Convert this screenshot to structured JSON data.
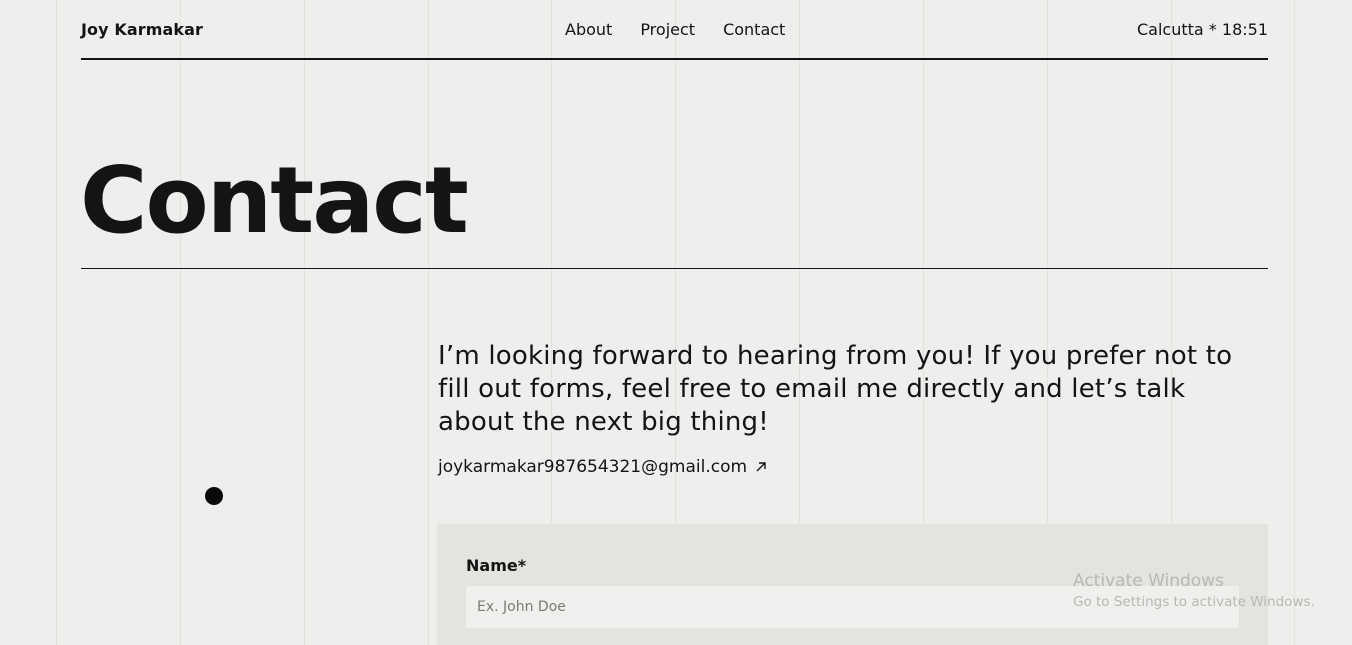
{
  "header": {
    "brand": "Joy Karmakar",
    "nav": [
      {
        "label": "About"
      },
      {
        "label": "Project"
      },
      {
        "label": "Contact"
      }
    ],
    "clock": "Calcutta * 18:51"
  },
  "main": {
    "title": "Contact",
    "intro": "I’m looking forward to hearing from you! If you prefer not to fill out forms, feel free to email me directly and let’s talk about the next big thing!",
    "email": "joykarmakar987654321@gmail.com",
    "email_icon": "arrow-up-right-icon"
  },
  "form": {
    "name_label": "Name*",
    "name_placeholder": "Ex. John Doe",
    "name_value": ""
  },
  "watermark": {
    "title": "Activate Windows",
    "subtitle": "Go to Settings to activate Windows."
  },
  "colors": {
    "background": "#efeeec",
    "text": "#141414",
    "form_panel": "#e5e3df",
    "input_bg": "#f0efed"
  }
}
